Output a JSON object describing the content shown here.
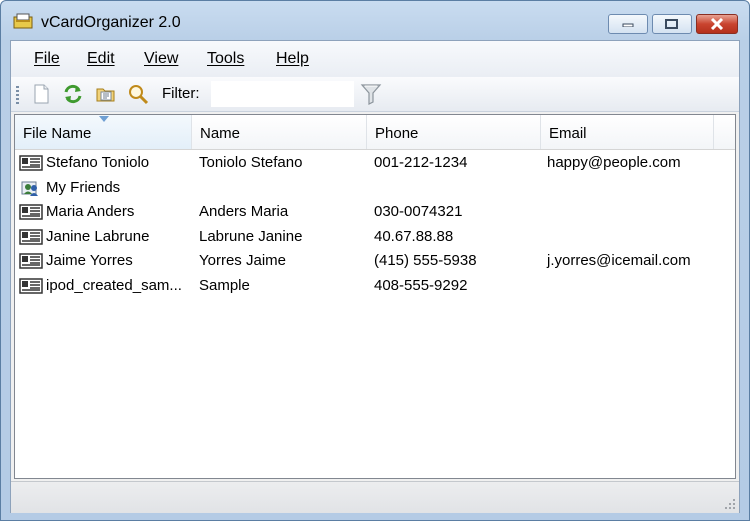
{
  "window": {
    "title": "vCardOrganizer 2.0",
    "controls": [
      "minimize-icon",
      "maximize-icon",
      "close-icon"
    ]
  },
  "menu": [
    {
      "label": "File"
    },
    {
      "label": "Edit"
    },
    {
      "label": "View"
    },
    {
      "label": "Tools"
    },
    {
      "label": "Help"
    }
  ],
  "toolbar": {
    "buttons": [
      "new-document-icon",
      "refresh-icon",
      "open-folder-icon",
      "search-icon"
    ],
    "filter_label": "Filter:",
    "filter_value": "",
    "filter_button": "funnel-icon"
  },
  "list": {
    "columns": [
      "File Name",
      "Name",
      "Phone",
      "Email"
    ],
    "sorted_column": "File Name",
    "rows": [
      {
        "icon": "vcard-icon",
        "file": "Stefano Toniolo",
        "name": "Toniolo Stefano",
        "phone": "001-212-1234",
        "email": "happy@people.com"
      },
      {
        "icon": "group-icon",
        "file": "My Friends",
        "name": "",
        "phone": "",
        "email": ""
      },
      {
        "icon": "vcard-icon",
        "file": "Maria Anders",
        "name": "Anders Maria",
        "phone": "030-0074321",
        "email": ""
      },
      {
        "icon": "vcard-icon",
        "file": "Janine Labrune",
        "name": "Labrune Janine",
        "phone": "40.67.88.88",
        "email": ""
      },
      {
        "icon": "vcard-icon",
        "file": "Jaime Yorres",
        "name": "Yorres Jaime",
        "phone": "(415) 555-5938",
        "email": "j.yorres@icemail.com"
      },
      {
        "icon": "vcard-icon",
        "file": "ipod_created_sam...",
        "name": "Sample",
        "phone": "408-555-9292",
        "email": ""
      }
    ]
  },
  "status": {
    "text": ""
  }
}
